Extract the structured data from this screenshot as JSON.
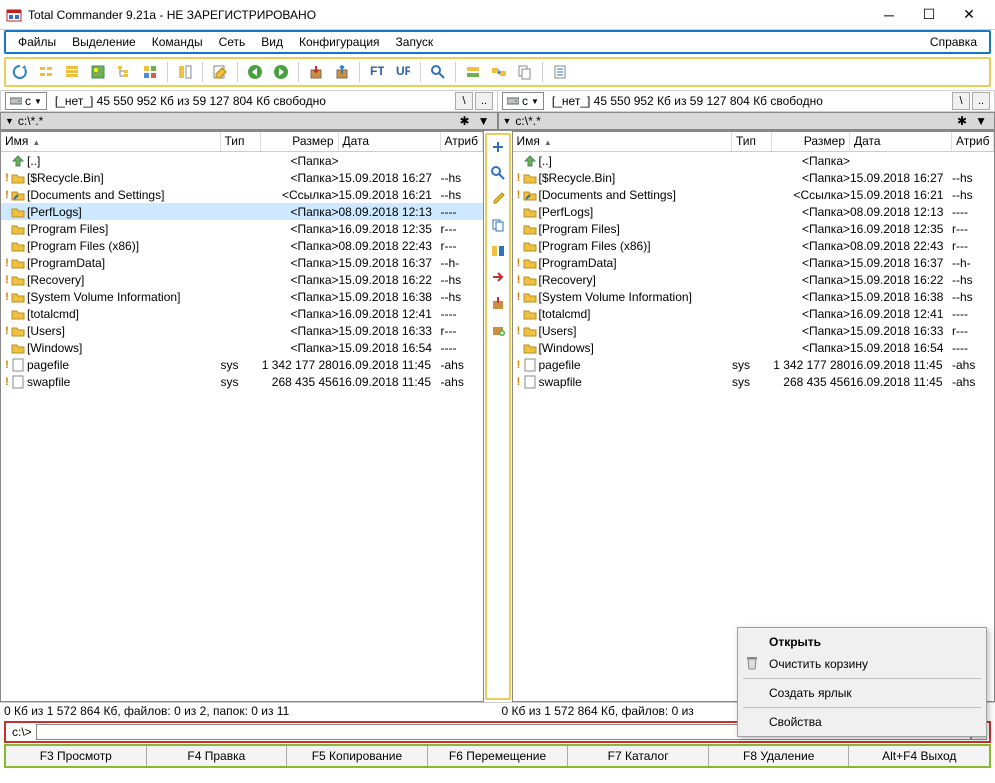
{
  "window": {
    "title": "Total Commander 9.21a - НЕ ЗАРЕГИСТРИРОВАНО"
  },
  "menu": {
    "items": [
      "Файлы",
      "Выделение",
      "Команды",
      "Сеть",
      "Вид",
      "Конфигурация",
      "Запуск"
    ],
    "help": "Справка"
  },
  "drive": {
    "letter": "c",
    "info": "[_нет_]  45 550 952 Кб из 59 127 804 Кб свободно",
    "btn_back": "\\",
    "btn_up": ".."
  },
  "path": "c:\\*.*",
  "columns": {
    "name": "Имя",
    "ext": "Тип",
    "size": "Размер",
    "date": "Дата",
    "attr": "Атриб"
  },
  "files": [
    {
      "excl": "",
      "icon": "up",
      "name": "[..]",
      "ext": "",
      "size": "<Папка>",
      "date": "",
      "attr": "",
      "sel": false
    },
    {
      "excl": "!",
      "icon": "folder",
      "name": "[$Recycle.Bin]",
      "ext": "",
      "size": "<Папка>",
      "date": "15.09.2018 16:27",
      "attr": "--hs",
      "sel": false
    },
    {
      "excl": "!",
      "icon": "link",
      "name": "[Documents and Settings]",
      "ext": "",
      "size": "<Ссылка>",
      "date": "15.09.2018 16:21",
      "attr": "--hs",
      "sel": false
    },
    {
      "excl": "",
      "icon": "folder",
      "name": "[PerfLogs]",
      "ext": "",
      "size": "<Папка>",
      "date": "08.09.2018 12:13",
      "attr": "----",
      "sel": true
    },
    {
      "excl": "",
      "icon": "folder",
      "name": "[Program Files]",
      "ext": "",
      "size": "<Папка>",
      "date": "16.09.2018 12:35",
      "attr": "r---",
      "sel": false
    },
    {
      "excl": "",
      "icon": "folder",
      "name": "[Program Files (x86)]",
      "ext": "",
      "size": "<Папка>",
      "date": "08.09.2018 22:43",
      "attr": "r---",
      "sel": false
    },
    {
      "excl": "!",
      "icon": "folder",
      "name": "[ProgramData]",
      "ext": "",
      "size": "<Папка>",
      "date": "15.09.2018 16:37",
      "attr": "--h-",
      "sel": false
    },
    {
      "excl": "!",
      "icon": "folder",
      "name": "[Recovery]",
      "ext": "",
      "size": "<Папка>",
      "date": "15.09.2018 16:22",
      "attr": "--hs",
      "sel": false
    },
    {
      "excl": "!",
      "icon": "folder",
      "name": "[System Volume Information]",
      "ext": "",
      "size": "<Папка>",
      "date": "15.09.2018 16:38",
      "attr": "--hs",
      "sel": false
    },
    {
      "excl": "",
      "icon": "folder",
      "name": "[totalcmd]",
      "ext": "",
      "size": "<Папка>",
      "date": "16.09.2018 12:41",
      "attr": "----",
      "sel": false
    },
    {
      "excl": "!",
      "icon": "folder",
      "name": "[Users]",
      "ext": "",
      "size": "<Папка>",
      "date": "15.09.2018 16:33",
      "attr": "r---",
      "sel": false
    },
    {
      "excl": "",
      "icon": "folder",
      "name": "[Windows]",
      "ext": "",
      "size": "<Папка>",
      "date": "15.09.2018 16:54",
      "attr": "----",
      "sel": false
    },
    {
      "excl": "!",
      "icon": "file",
      "name": "pagefile",
      "ext": "sys",
      "size": "1 342 177 280",
      "date": "16.09.2018 11:45",
      "attr": "-ahs",
      "sel": false
    },
    {
      "excl": "!",
      "icon": "file",
      "name": "swapfile",
      "ext": "sys",
      "size": "268 435 456",
      "date": "16.09.2018 11:45",
      "attr": "-ahs",
      "sel": false
    }
  ],
  "status": "0 Кб из 1 572 864 Кб, файлов: 0 из 2, папок: 0 из 11",
  "status_right": "0 Кб из 1 572 864 Кб, файлов: 0 из",
  "cmdline": {
    "prompt": "c:\\>"
  },
  "fnkeys": [
    "F3 Просмотр",
    "F4 Правка",
    "F5 Копирование",
    "F6 Перемещение",
    "F7 Каталог",
    "F8 Удаление",
    "Alt+F4 Выход"
  ],
  "context_menu": {
    "open": "Открыть",
    "empty": "Очистить корзину",
    "shortcut": "Создать ярлык",
    "properties": "Свойства"
  },
  "toolbar_icons": [
    "refresh",
    "view-brief",
    "view-full",
    "view-thumbs",
    "view-tree",
    "view-custom",
    "sep",
    "view-quick",
    "sep",
    "edit",
    "sep",
    "back",
    "forward",
    "sep",
    "pack",
    "unpack",
    "sep",
    "ftp",
    "url",
    "sep",
    "search",
    "sep",
    "multi-rename",
    "sync-dirs",
    "copy-names",
    "sep",
    "notepad"
  ],
  "vtoolbar_icons": [
    "expand",
    "search",
    "edit-file",
    "copy",
    "two-panel",
    "move",
    "pack-v",
    "unpack-v"
  ]
}
